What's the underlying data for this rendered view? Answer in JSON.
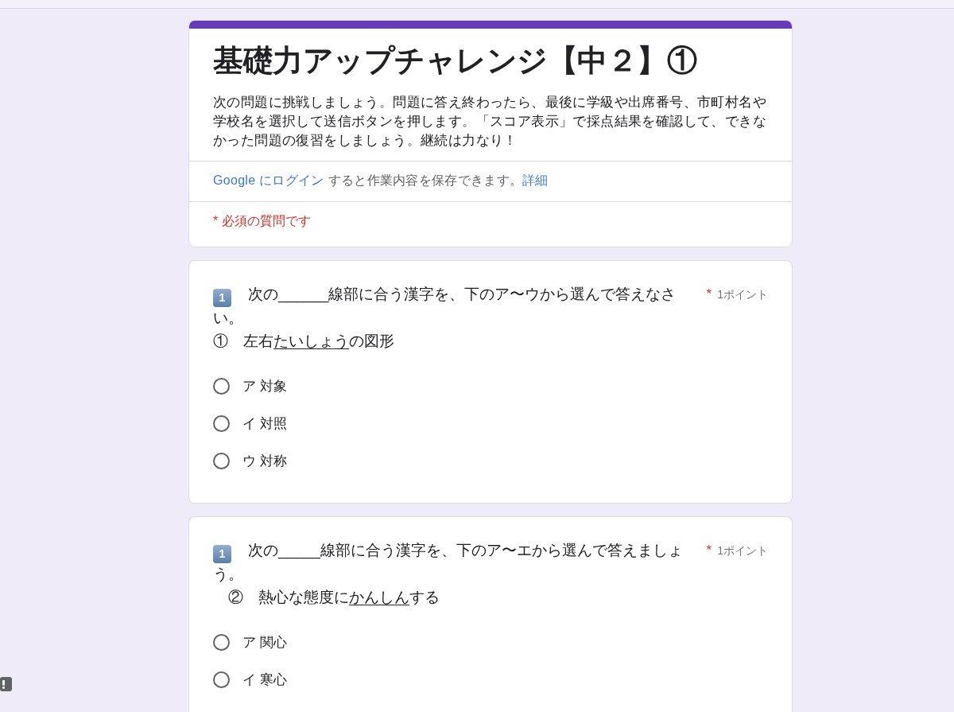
{
  "form_header": {
    "title": "基礎力アップチャレンジ【中２】①",
    "description": "次の問題に挑戦しましょう。問題に答え終わったら、最後に学級や出席番号、市町村名や学校名を選択して送信ボタンを押します。「スコア表示」で採点結果を確認して、できなかった問題の復習をしましょう。継続は力なり！",
    "sign_in_notice": {
      "sign_in_link": "Google にログイン",
      "text": "すると作業内容を保存できます。",
      "details_link": "詳細"
    },
    "required_note": "* 必須の質問です"
  },
  "questions": [
    {
      "badge": "1",
      "prompt": "次の______線部に合う漢字を、下のア〜ウから選んで答えなさい。",
      "item": {
        "before": "①　左右",
        "underlined": "たいしょう",
        "after": "の図形"
      },
      "required_mark": "*",
      "points": "1ポイント",
      "options": [
        {
          "label": "ア 対象",
          "selected": false
        },
        {
          "label": "イ 対照",
          "selected": false
        },
        {
          "label": "ウ 対称",
          "selected": false
        }
      ]
    },
    {
      "badge": "1",
      "prompt": "次の_____線部に合う漢字を、下のア〜エから選んで答えましょう。",
      "item": {
        "before": "　②　熱心な態度に",
        "underlined": "かんしん",
        "after": "する"
      },
      "required_mark": "*",
      "points": "1ポイント",
      "options": [
        {
          "label": "ア 関心",
          "selected": false
        },
        {
          "label": "イ 寒心",
          "selected": false
        }
      ]
    }
  ]
}
